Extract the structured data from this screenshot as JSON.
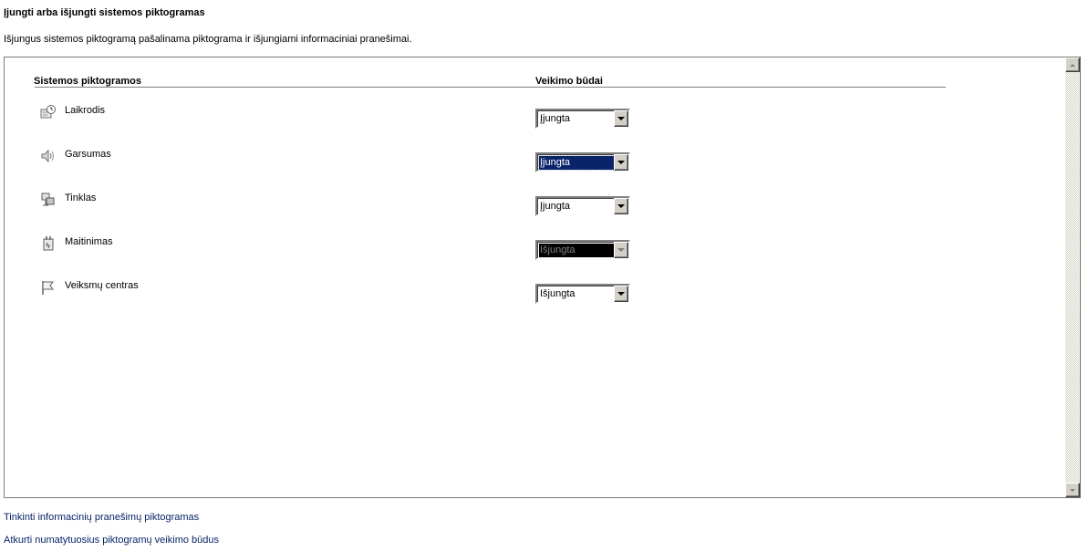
{
  "page": {
    "title": "Įjungti arba išjungti sistemos piktogramas",
    "description": "Išjungus sistemos piktogramą pašalinama piktograma ir išjungiami informaciniai pranešimai."
  },
  "table": {
    "col_icons": "Sistemos piktogramos",
    "col_behaviors": "Veikimo būdai",
    "rows": [
      {
        "label": "Laikrodis",
        "icon": "clock-icon",
        "value": "Įjungta"
      },
      {
        "label": "Garsumas",
        "icon": "volume-icon",
        "value": "Įjungta"
      },
      {
        "label": "Tinklas",
        "icon": "network-icon",
        "value": "Įjungta"
      },
      {
        "label": "Maitinimas",
        "icon": "power-icon",
        "value": "Išjungta"
      },
      {
        "label": "Veiksmų centras",
        "icon": "flag-icon",
        "value": "Išjungta"
      }
    ]
  },
  "links": {
    "customize": "Tinkinti informacinių pranešimų piktogramas",
    "restore": "Atkurti numatytuosius piktogramų veikimo būdus"
  }
}
